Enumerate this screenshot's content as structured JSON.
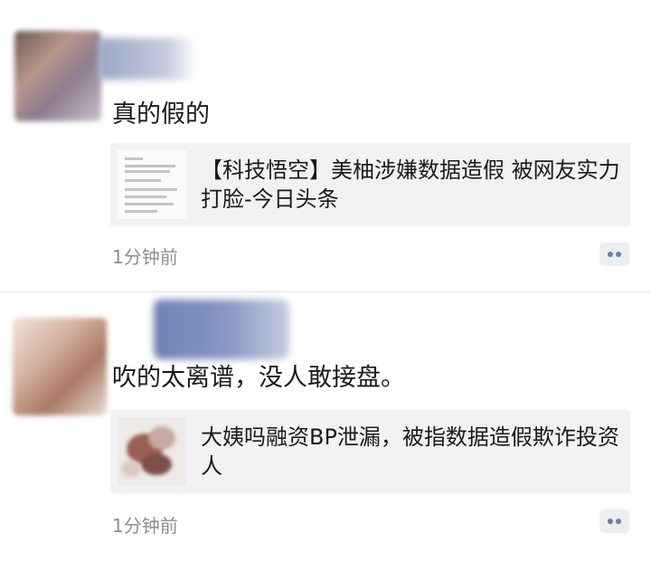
{
  "feed": {
    "posts": [
      {
        "text": "真的假的",
        "link": {
          "title": "【科技悟空】美柚涉嫌数据造假 被网友实力打脸-今日头条",
          "thumbnail": "document-screenshot"
        },
        "timestamp": "1分钟前",
        "action_icon": "comment-more-icon"
      },
      {
        "text": "吹的太离谱，没人敢接盘。",
        "link": {
          "title": "大姨吗融资BP泄漏，被指数据造假欺诈投资人",
          "thumbnail": "photo"
        },
        "timestamp": "1分钟前",
        "action_icon": "comment-more-icon"
      }
    ]
  },
  "colors": {
    "text": "#1a1a1a",
    "timestamp": "#8e8e93",
    "card_background": "#f2f2f4",
    "action_dots": "#6a7fa6"
  }
}
